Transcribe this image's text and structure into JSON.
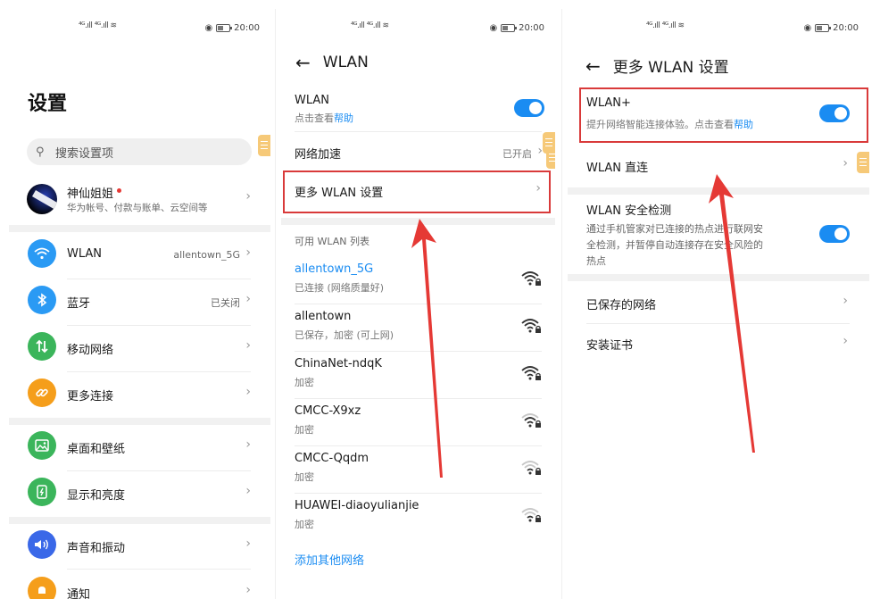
{
  "status_bar": {
    "left": "⁴ᴳ.ıll ⁴ᴳ.ıll ≋",
    "time": "20:00"
  },
  "settings": {
    "title": "设置",
    "search_placeholder": "搜索设置项",
    "account": {
      "name": "神仙姐姐",
      "sub": "华为帐号、付款与账单、云空间等"
    },
    "items": [
      {
        "label": "WLAN",
        "value": "allentown_5G",
        "icon": "wifi-icon",
        "color": "#2a9af4"
      },
      {
        "label": "蓝牙",
        "value": "已关闭",
        "icon": "bluetooth-icon",
        "color": "#2a9af4"
      },
      {
        "label": "移动网络",
        "value": "",
        "icon": "mobile-data-icon",
        "color": "#3bb55b"
      },
      {
        "label": "更多连接",
        "value": "",
        "icon": "link-icon",
        "color": "#f59e1b"
      },
      {
        "label": "桌面和壁纸",
        "value": "",
        "icon": "wallpaper-icon",
        "color": "#3bb55b"
      },
      {
        "label": "显示和亮度",
        "value": "",
        "icon": "display-icon",
        "color": "#3bb55b"
      },
      {
        "label": "声音和振动",
        "value": "",
        "icon": "sound-icon",
        "color": "#3a68e8"
      },
      {
        "label": "通知",
        "value": "",
        "icon": "bell-icon",
        "color": "#f59e1b"
      }
    ]
  },
  "wlan": {
    "title": "WLAN",
    "toggle_label": "WLAN",
    "toggle_sub_prefix": "点击查看",
    "toggle_sub_link": "帮助",
    "toggle_on": true,
    "accel_label": "网络加速",
    "accel_value": "已开启",
    "more_label": "更多 WLAN 设置",
    "list_header": "可用 WLAN 列表",
    "networks": [
      {
        "name": "allentown_5G",
        "status": "已连接 (网络质量好)",
        "connected": true,
        "strength": 3
      },
      {
        "name": "allentown",
        "status": "已保存，加密 (可上网)",
        "connected": false,
        "strength": 3
      },
      {
        "name": "ChinaNet-ndqK",
        "status": "加密",
        "connected": false,
        "strength": 3
      },
      {
        "name": "CMCC-X9xz",
        "status": "加密",
        "connected": false,
        "strength": 2
      },
      {
        "name": "CMCC-Qqdm",
        "status": "加密",
        "connected": false,
        "strength": 1
      },
      {
        "name": "HUAWEI-diaoyulianjie",
        "status": "加密",
        "connected": false,
        "strength": 1
      }
    ],
    "add_other": "添加其他网络"
  },
  "more_wlan": {
    "title": "更多 WLAN 设置",
    "wlan_plus_label": "WLAN+",
    "wlan_plus_sub_prefix": "提升网络智能连接体验。点击查看",
    "wlan_plus_sub_link": "帮助",
    "wlan_plus_on": true,
    "direct_label": "WLAN 直连",
    "security_label": "WLAN 安全检测",
    "security_sub_1": "通过手机管家对已连接的热点进行联网安",
    "security_sub_2": "全检测，并暂停自动连接存在安全风险的",
    "security_sub_3": "热点",
    "security_on": true,
    "saved_label": "已保存的网络",
    "cert_label": "安装证书"
  },
  "colors": {
    "accent": "#1a8cf2",
    "highlight": "#d93a3a",
    "arrow": "#e53935"
  }
}
